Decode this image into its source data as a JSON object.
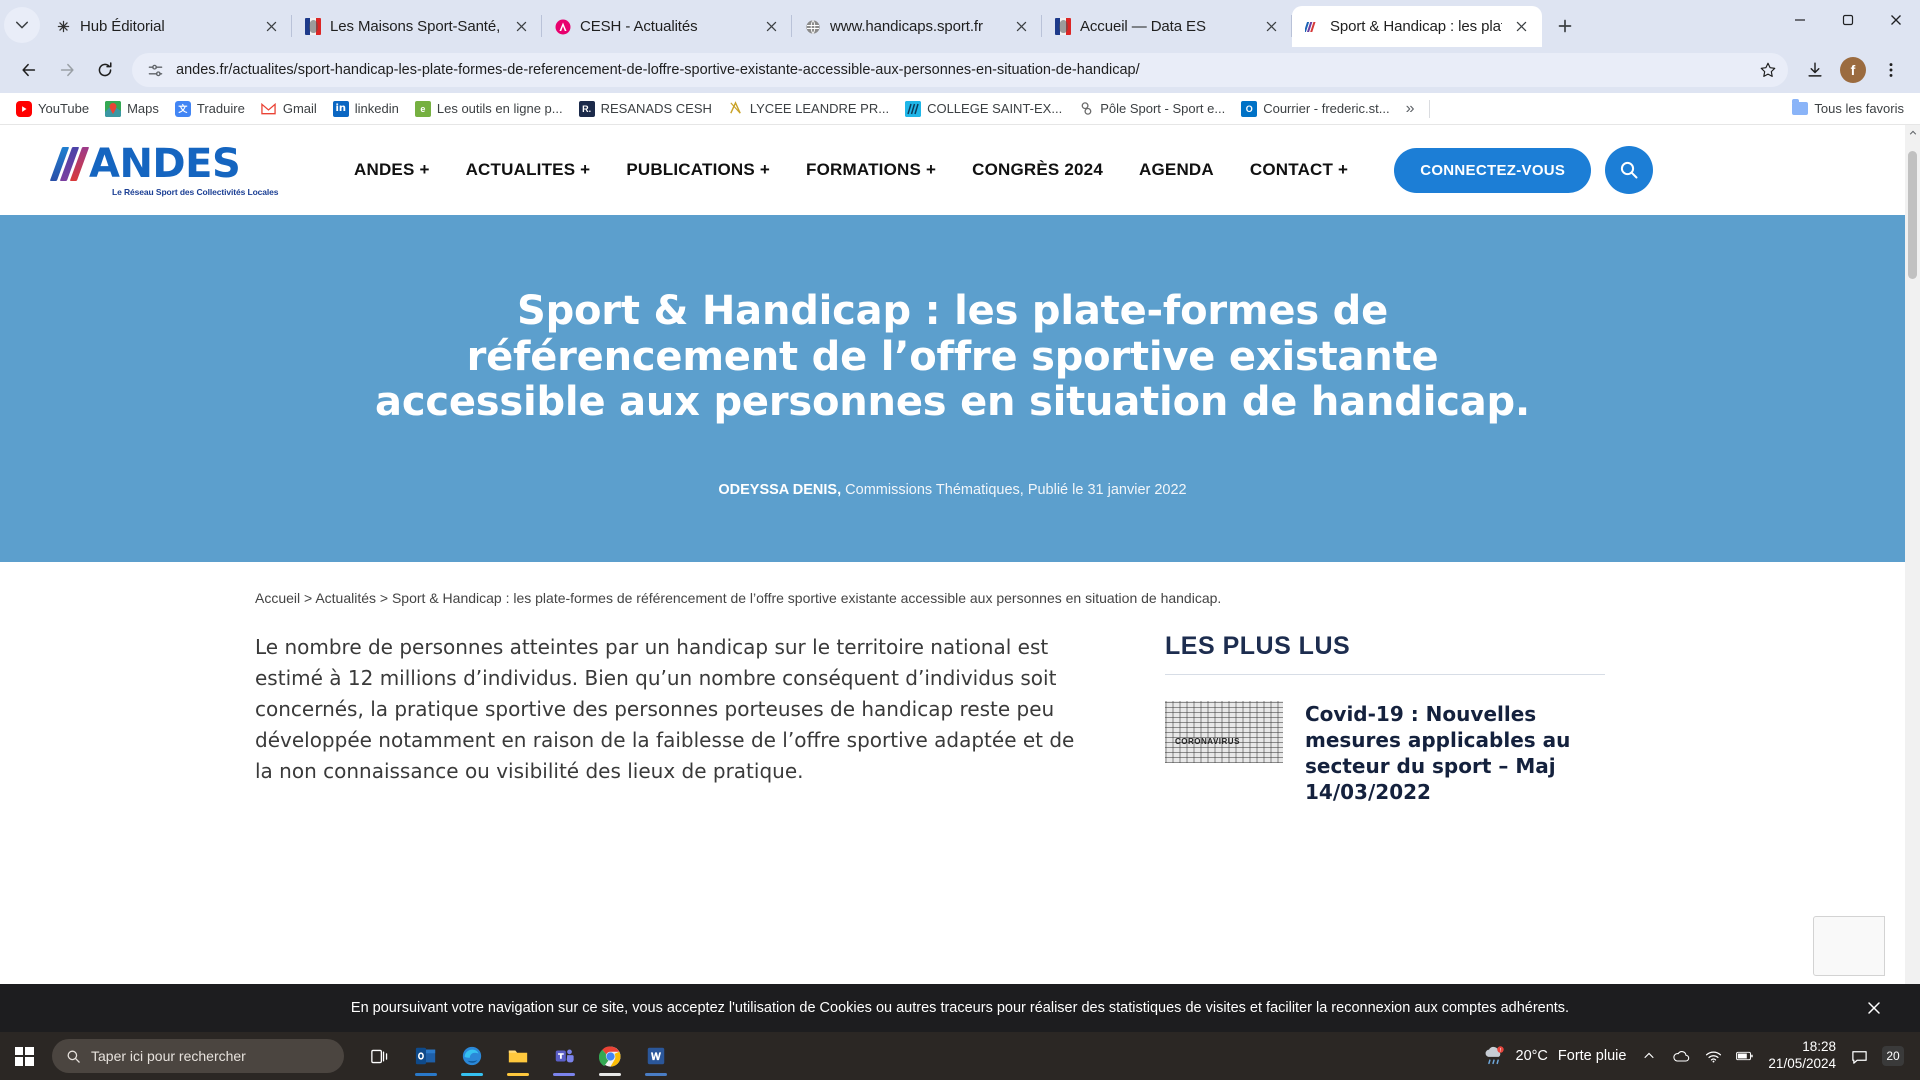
{
  "browser": {
    "tabs": [
      {
        "title": "Hub Éditorial",
        "favicon": "hub-icon",
        "active": false
      },
      {
        "title": "Les Maisons Sport-Santé, u",
        "favicon": "fr-flag-icon",
        "active": false
      },
      {
        "title": "CESH - Actualités",
        "favicon": "cesh-icon",
        "active": false
      },
      {
        "title": "www.handicaps.sport.fr",
        "favicon": "globe-icon",
        "active": false
      },
      {
        "title": "Accueil — Data ES",
        "favicon": "fr-flag-icon",
        "active": false
      },
      {
        "title": "Sport & Handicap : les plat",
        "favicon": "andes-icon",
        "active": true
      }
    ],
    "url": "andes.fr/actualites/sport-handicap-les-plate-formes-de-referencement-de-loffre-sportive-existante-accessible-aux-personnes-en-situation-de-handicap/",
    "profile_initial": "f",
    "bookmarks": [
      {
        "label": "YouTube",
        "icon": "youtube-icon",
        "color": "#ff0000"
      },
      {
        "label": "Maps",
        "icon": "maps-icon",
        "color": "#34a853"
      },
      {
        "label": "Traduire",
        "icon": "translate-icon",
        "color": "#4285f4"
      },
      {
        "label": "Gmail",
        "icon": "gmail-icon",
        "color": "#ea4335"
      },
      {
        "label": "linkedin",
        "icon": "linkedin-icon",
        "color": "#0a66c2"
      },
      {
        "label": "Les outils en ligne p...",
        "icon": "outils-icon",
        "color": "#76b041"
      },
      {
        "label": "RESANADS CESH",
        "icon": "resanads-icon",
        "color": "#1b2a4a"
      },
      {
        "label": "LYCEE LEANDRE PR...",
        "icon": "lycee-icon",
        "color": "#c9a227"
      },
      {
        "label": "COLLEGE SAINT-EX...",
        "icon": "college-icon",
        "color": "#1fb6e8"
      },
      {
        "label": "Pôle Sport - Sport e...",
        "icon": "pole-sport-icon",
        "color": "#6b6b6b"
      },
      {
        "label": "Courrier - frederic.st...",
        "icon": "outlook-icon",
        "color": "#0072c6"
      }
    ],
    "bookmarks_overflow": "»",
    "all_bookmarks_label": "Tous les favoris"
  },
  "site": {
    "logo_text": "ANDES",
    "logo_tagline": "Le Réseau Sport des Collectivités Locales",
    "nav": [
      {
        "label": "ANDES",
        "has_plus": true
      },
      {
        "label": "ACTUALITES",
        "has_plus": true
      },
      {
        "label": "PUBLICATIONS",
        "has_plus": true
      },
      {
        "label": "FORMATIONS",
        "has_plus": true
      },
      {
        "label": "CONGRÈS 2024",
        "has_plus": false
      },
      {
        "label": "AGENDA",
        "has_plus": false
      },
      {
        "label": "CONTACT",
        "has_plus": true
      }
    ],
    "login_label": "CONNECTEZ-VOUS",
    "accent_color": "#1c7ed6",
    "hero_bg_color": "#5c9fcd"
  },
  "hero": {
    "title": "Sport & Handicap : les plate-formes de référencement de l’offre sportive existante accessible aux personnes en situation de handicap.",
    "author": "ODEYSSA DENIS,",
    "meta": " Commissions Thématiques, Publié le 31 janvier 2022"
  },
  "breadcrumb": {
    "home": "Accueil",
    "sep1": " > ",
    "section": "Actualités",
    "sep2": " > ",
    "current": "Sport & Handicap : les plate-formes de référencement de l’offre sportive existante accessible aux personnes en situation de handicap.",
    "full": "Accueil > Actualités > Sport & Handicap : les plate-formes de référencement de l’offre sportive existante accessible aux personnes en situation de handicap."
  },
  "article": {
    "paragraph1": "Le nombre de personnes atteintes par un handicap sur le territoire national est estimé à 12 millions d’individus. Bien qu’un nombre conséquent d’individus soit concernés, la pratique sportive des personnes porteuses de handicap reste peu développée notamment en raison de la faiblesse de l’offre sportive adaptée et de la non connaissance ou visibilité des lieux de pratique."
  },
  "aside": {
    "heading": "LES PLUS LUS",
    "items": [
      {
        "title": "Covid-19 : Nouvelles mesures applicables au secteur du sport – Maj 14/03/2022",
        "thumb_word": "CORONAVIRUS"
      }
    ]
  },
  "cookie": {
    "message": "En poursuivant votre navigation sur ce site, vous acceptez l'utilisation de Cookies ou autres traceurs pour réaliser des statistiques de visites et faciliter la reconnexion aux comptes adhérents.",
    "close_icon": "close-icon"
  },
  "taskbar": {
    "search_placeholder": "Taper ici pour rechercher",
    "apps": [
      {
        "name": "task-view-icon",
        "color": "#ffffff"
      },
      {
        "name": "outlook-icon",
        "color": "#0072c6"
      },
      {
        "name": "edge-icon",
        "color": "#2b88d8"
      },
      {
        "name": "file-explorer-icon",
        "color": "#ffc83d"
      },
      {
        "name": "teams-icon",
        "color": "#6264a7"
      },
      {
        "name": "chrome-icon",
        "color": "#4285f4"
      },
      {
        "name": "word-icon",
        "color": "#2b579a"
      }
    ],
    "weather_temp": "20°C",
    "weather_desc": "Forte pluie",
    "time": "18:28",
    "date": "21/05/2024",
    "notification_count": "20"
  }
}
